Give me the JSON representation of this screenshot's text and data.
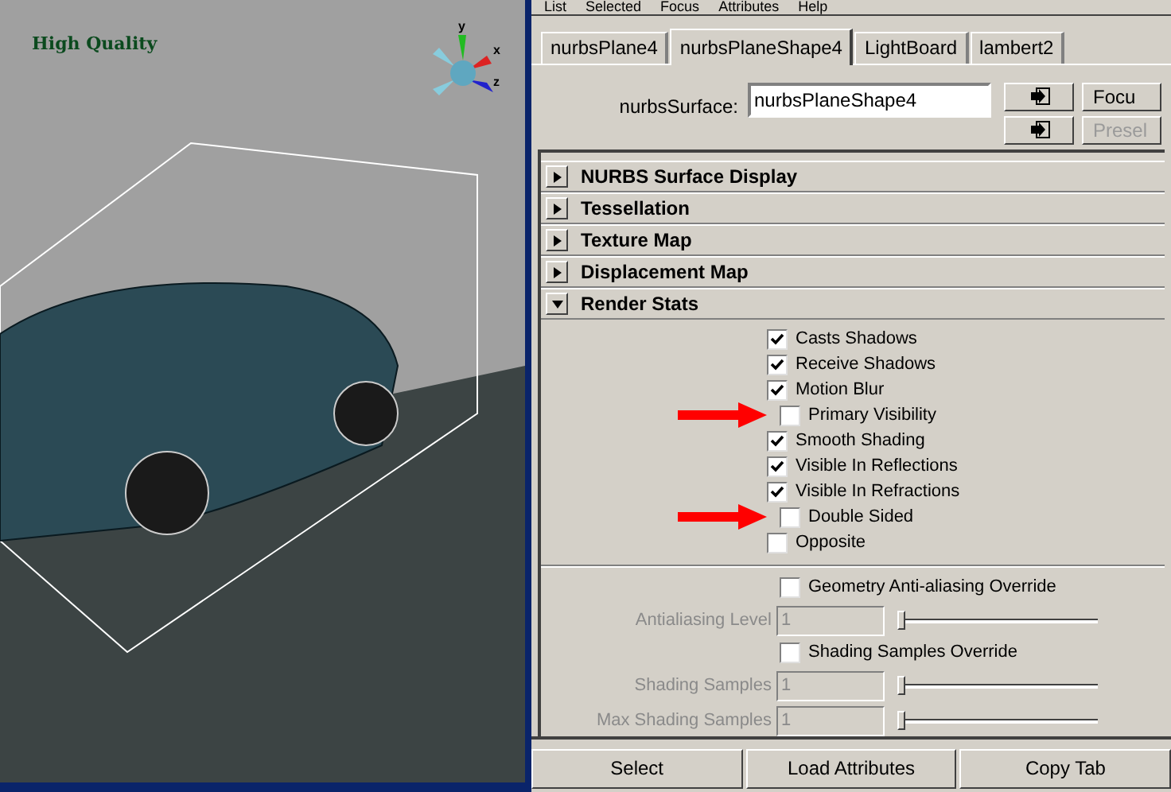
{
  "viewport": {
    "overlay_text": "High Quality",
    "gizmo_labels": [
      "y",
      "x",
      "z"
    ]
  },
  "menu": [
    "List",
    "Selected",
    "Focus",
    "Attributes",
    "Help"
  ],
  "tabs": [
    {
      "label": "nurbsPlane4",
      "selected": false
    },
    {
      "label": "nurbsPlaneShape4",
      "selected": true
    },
    {
      "label": "LightBoard",
      "selected": false
    },
    {
      "label": "lambert2",
      "selected": false
    }
  ],
  "node_field": {
    "label": "nurbsSurface:",
    "value": "nurbsPlaneShape4"
  },
  "side_buttons": [
    {
      "label": "Focu",
      "disabled": false
    },
    {
      "label": "Presel",
      "disabled": true
    }
  ],
  "sections": [
    {
      "title": "NURBS Surface Display",
      "expanded": false
    },
    {
      "title": "Tessellation",
      "expanded": false
    },
    {
      "title": "Texture Map",
      "expanded": false
    },
    {
      "title": "Displacement Map",
      "expanded": false
    },
    {
      "title": "Render Stats",
      "expanded": true
    }
  ],
  "render_stats": [
    {
      "label": "Casts Shadows",
      "checked": true,
      "marked": false
    },
    {
      "label": "Receive Shadows",
      "checked": true,
      "marked": false
    },
    {
      "label": "Motion Blur",
      "checked": true,
      "marked": false
    },
    {
      "label": "Primary Visibility",
      "checked": false,
      "marked": true
    },
    {
      "label": "Smooth Shading",
      "checked": true,
      "marked": false
    },
    {
      "label": "Visible In Reflections",
      "checked": true,
      "marked": false
    },
    {
      "label": "Visible In Refractions",
      "checked": true,
      "marked": false
    },
    {
      "label": "Double Sided",
      "checked": false,
      "marked": true
    },
    {
      "label": "Opposite",
      "checked": false,
      "marked": false
    }
  ],
  "overrides": [
    {
      "kind": "checkbox",
      "label": "Geometry Anti-aliasing Override",
      "checked": false
    },
    {
      "kind": "slider",
      "label": "Antialiasing Level",
      "value": "1",
      "level": 0.0,
      "disabled": true
    },
    {
      "kind": "checkbox",
      "label": "Shading Samples Override",
      "checked": false
    },
    {
      "kind": "slider",
      "label": "Shading Samples",
      "value": "1",
      "level": 0.0,
      "disabled": true
    },
    {
      "kind": "slider",
      "label": "Max Shading Samples",
      "value": "1",
      "level": 0.0,
      "disabled": true
    }
  ],
  "buttons": [
    "Select",
    "Load Attributes",
    "Copy Tab"
  ]
}
